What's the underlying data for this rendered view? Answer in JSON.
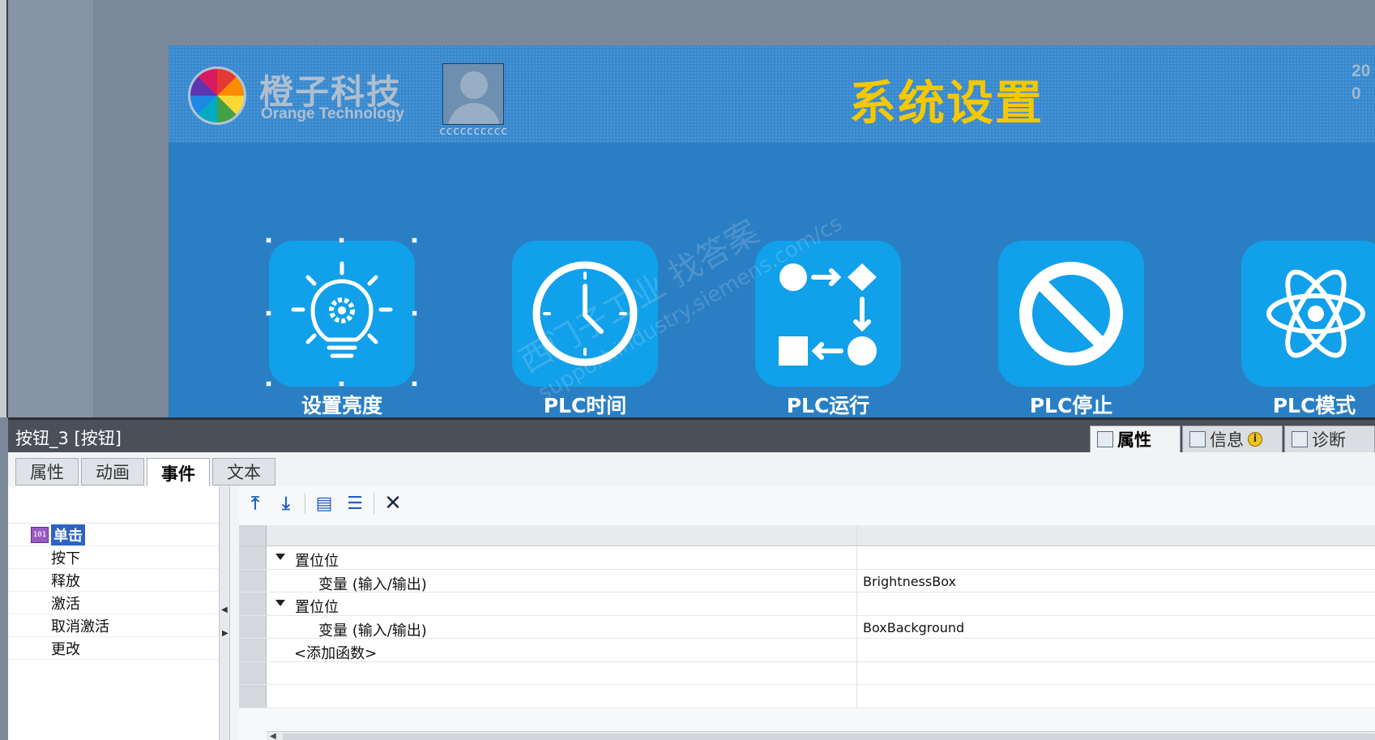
{
  "hmi": {
    "company_cn": "橙子科技",
    "company_en": "Orange Technology",
    "user_name": "cccccccccc",
    "screen_title": "系统设置",
    "clock_line1": "20",
    "clock_line2": "0",
    "tiles": [
      {
        "label": "设置亮度",
        "icon": "lightbulb-gear-icon"
      },
      {
        "label": "PLC时间",
        "icon": "clock-icon"
      },
      {
        "label": "PLC运行",
        "icon": "flow-icon"
      },
      {
        "label": "PLC停止",
        "icon": "prohibited-icon"
      },
      {
        "label": "PLC模式",
        "icon": "atom-icon"
      }
    ],
    "watermark_line1": "西门子工业  找答案",
    "watermark_line2": "support.industry.siemens.com/cs"
  },
  "inspector": {
    "title": "按钮_3 [按钮]",
    "right_tabs": [
      {
        "label": "属性",
        "icon": "properties-icon",
        "active": true
      },
      {
        "label": "信息",
        "icon": "info-icon",
        "active": false
      },
      {
        "label": "诊断",
        "icon": "diagnostics-icon",
        "active": false
      }
    ],
    "sub_tabs": [
      {
        "label": "属性",
        "active": false
      },
      {
        "label": "动画",
        "active": false
      },
      {
        "label": "事件",
        "active": true
      },
      {
        "label": "文本",
        "active": false
      }
    ],
    "events": [
      "单击",
      "按下",
      "释放",
      "激活",
      "取消激活",
      "更改"
    ],
    "selected_event": "单击",
    "functions": [
      {
        "name": "置位位",
        "param": "变量 (输入/输出)",
        "value": "BrightnessBox"
      },
      {
        "name": "置位位",
        "param": "变量 (输入/输出)",
        "value": "BoxBackground"
      }
    ],
    "add_function": "<添加函数>",
    "toolbar_icons": [
      "move-up-icon",
      "move-down-icon",
      "expand-all-icon",
      "collapse-all-icon",
      "delete-icon"
    ]
  },
  "colors": {
    "screen_bg": "#2a7fc4",
    "tile_bg": "#11a0ea",
    "title_yellow": "#f5c800",
    "selection_blue": "#2b63c7"
  }
}
